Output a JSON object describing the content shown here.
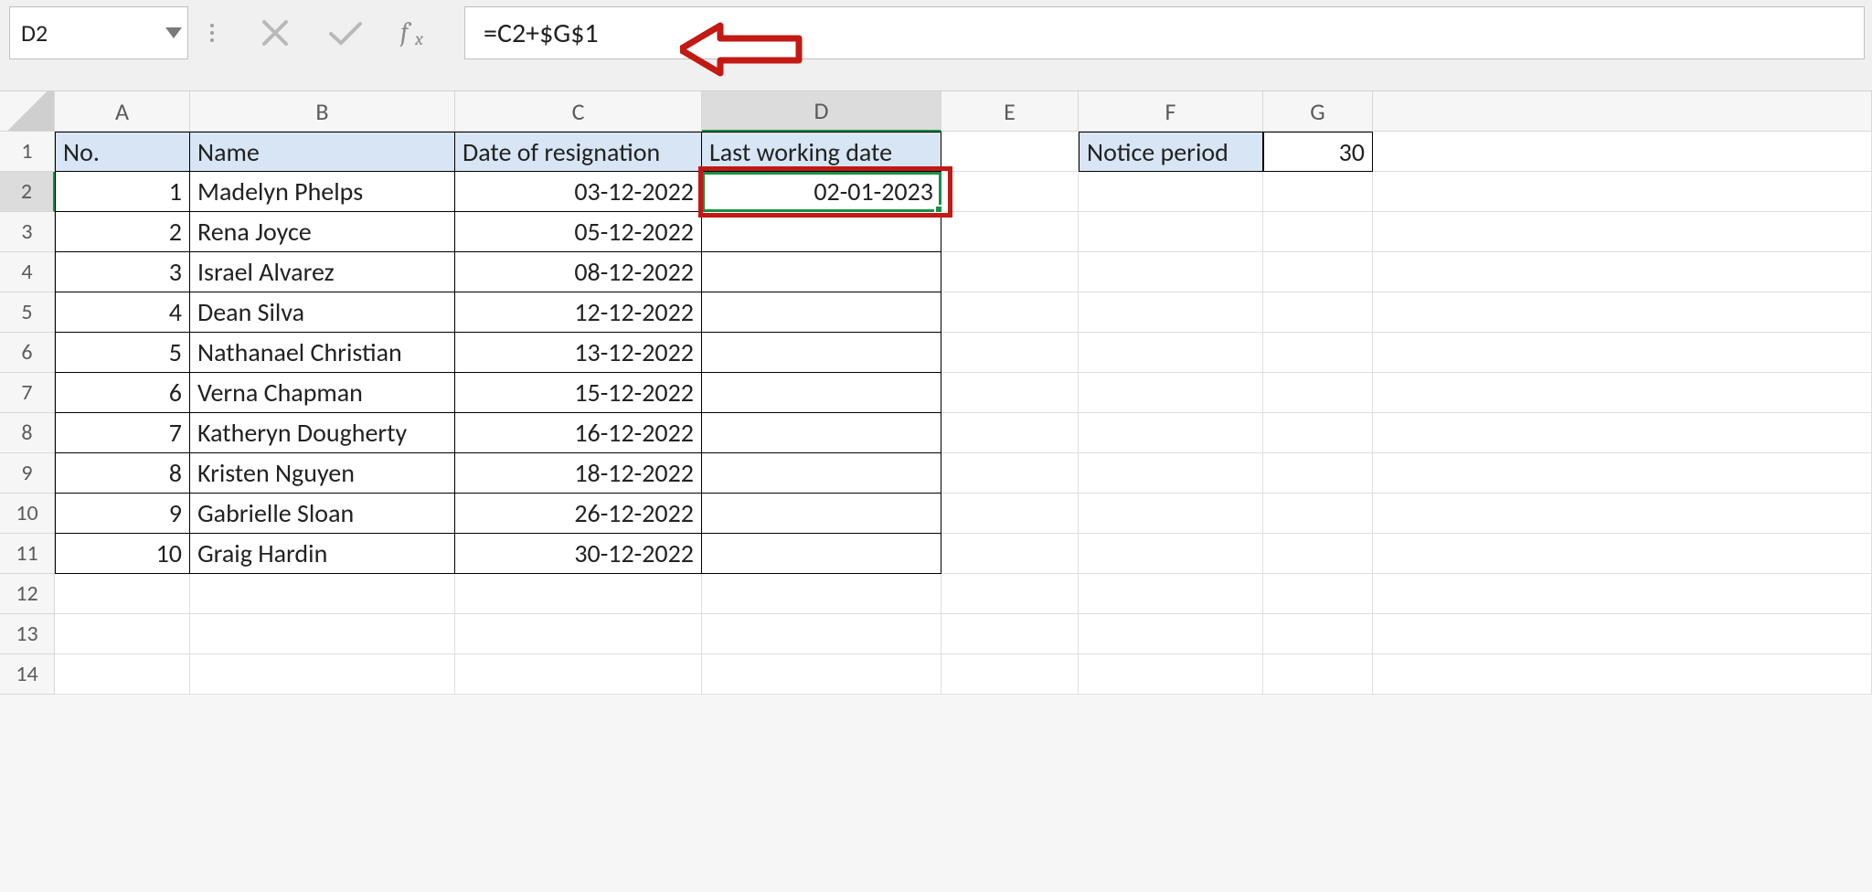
{
  "name_box": "D2",
  "formula": "=C2+$G$1",
  "col_labels": {
    "A": "A",
    "B": "B",
    "C": "C",
    "D": "D",
    "E": "E",
    "F": "F",
    "G": "G"
  },
  "row_labels": [
    "1",
    "2",
    "3",
    "4",
    "5",
    "6",
    "7",
    "8",
    "9",
    "10",
    "11",
    "12",
    "13",
    "14"
  ],
  "headers": {
    "A": "No.",
    "B": "Name",
    "C": "Date of resignation",
    "D": "Last working date",
    "F": "Notice period",
    "G": "30"
  },
  "rows": [
    {
      "no": "1",
      "name": "Madelyn Phelps",
      "resign": "03-12-2022",
      "last": "02-01-2023"
    },
    {
      "no": "2",
      "name": "Rena Joyce",
      "resign": "05-12-2022",
      "last": ""
    },
    {
      "no": "3",
      "name": "Israel Alvarez",
      "resign": "08-12-2022",
      "last": ""
    },
    {
      "no": "4",
      "name": "Dean Silva",
      "resign": "12-12-2022",
      "last": ""
    },
    {
      "no": "5",
      "name": "Nathanael Christian",
      "resign": "13-12-2022",
      "last": ""
    },
    {
      "no": "6",
      "name": "Verna Chapman",
      "resign": "15-12-2022",
      "last": ""
    },
    {
      "no": "7",
      "name": "Katheryn Dougherty",
      "resign": "16-12-2022",
      "last": ""
    },
    {
      "no": "8",
      "name": "Kristen Nguyen",
      "resign": "18-12-2022",
      "last": ""
    },
    {
      "no": "9",
      "name": "Gabrielle Sloan",
      "resign": "26-12-2022",
      "last": ""
    },
    {
      "no": "10",
      "name": "Graig Hardin",
      "resign": "30-12-2022",
      "last": ""
    }
  ]
}
